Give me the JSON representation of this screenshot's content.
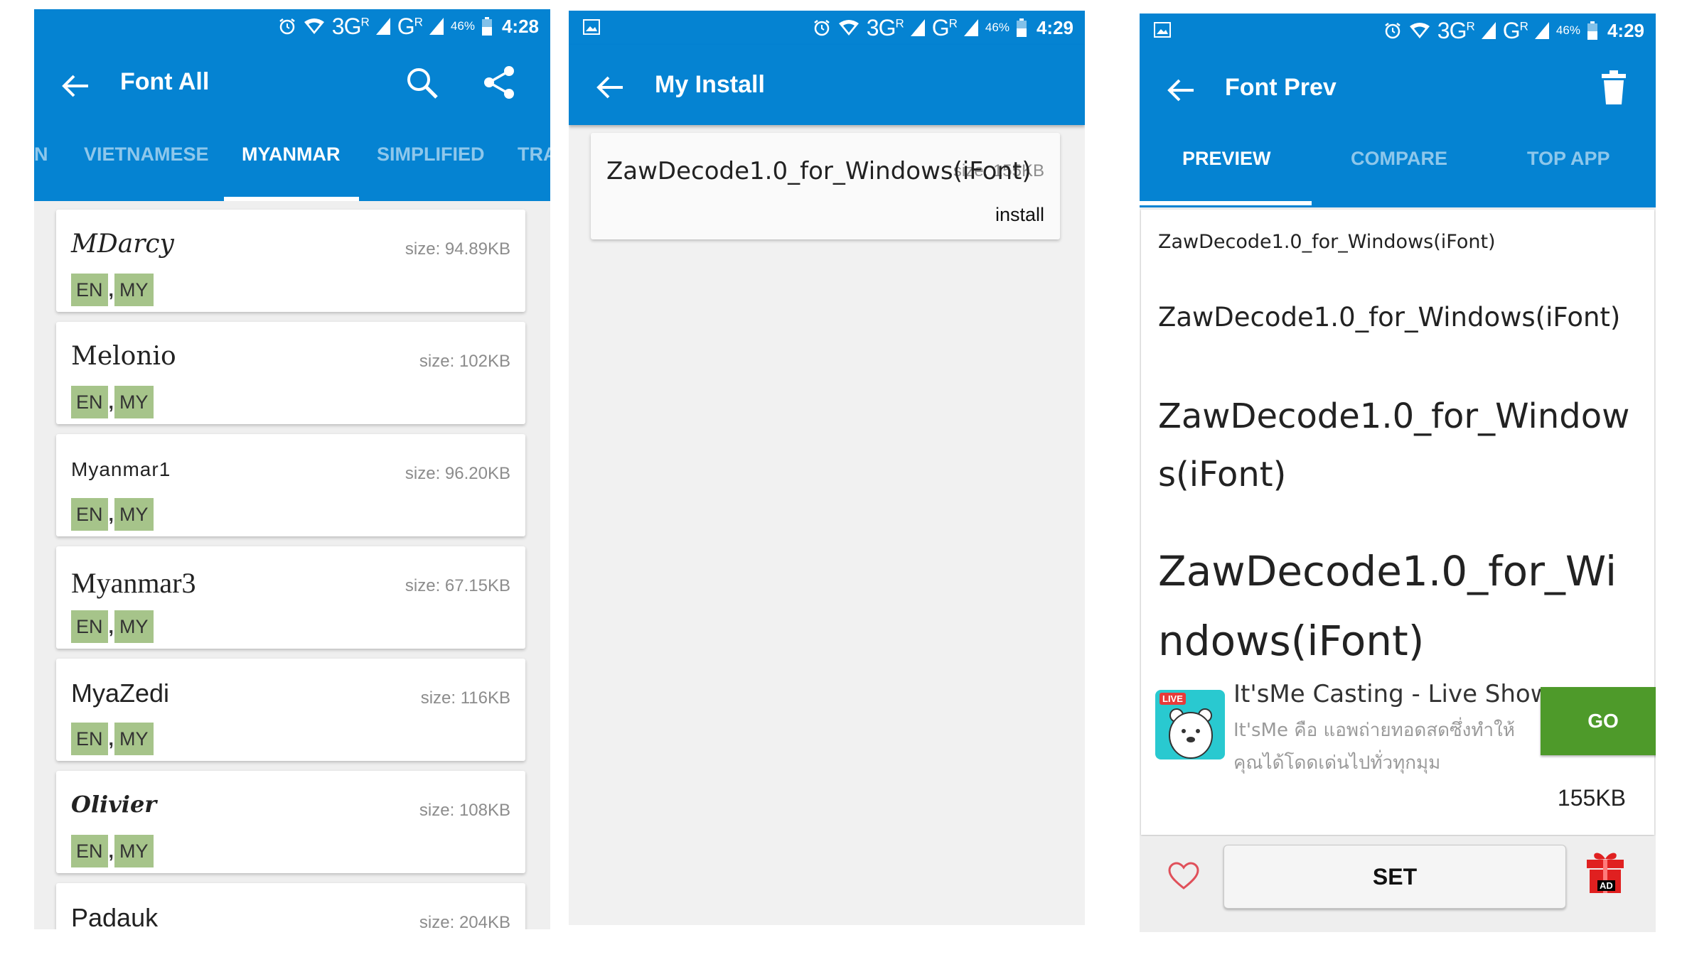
{
  "statusbar": {
    "screen1": {
      "battery": "46%",
      "time": "4:28",
      "net1": "3G",
      "net2": "G",
      "roaming": "R"
    },
    "screen2": {
      "battery": "46%",
      "time": "4:29",
      "net1": "3G",
      "net2": "G",
      "roaming": "R"
    },
    "screen3": {
      "battery": "46%",
      "time": "4:29",
      "net1": "3G",
      "net2": "G",
      "roaming": "R"
    }
  },
  "screen1": {
    "title": "Font All",
    "tabs": [
      "N",
      "VIETNAMESE",
      "MYANMAR",
      "SIMPLIFIED",
      "TRA"
    ],
    "active_tab": "MYANMAR",
    "fonts": [
      {
        "name": "MDarcy",
        "size": "size: 94.89KB",
        "tag1": "EN",
        "sep": ",",
        "tag2": "MY"
      },
      {
        "name": "Melonio",
        "size": "size: 102KB",
        "tag1": "EN",
        "sep": ",",
        "tag2": "MY"
      },
      {
        "name": "Myanmar1",
        "size": "size: 96.20KB",
        "tag1": "EN",
        "sep": ",",
        "tag2": "MY"
      },
      {
        "name": "Myanmar3",
        "size": "size: 67.15KB",
        "tag1": "EN",
        "sep": ",",
        "tag2": "MY"
      },
      {
        "name": "MyaZedi",
        "size": "size: 116KB",
        "tag1": "EN",
        "sep": ",",
        "tag2": "MY"
      },
      {
        "name": "Olivier",
        "size": "size: 108KB",
        "tag1": "EN",
        "sep": ",",
        "tag2": "MY"
      },
      {
        "name": "Padauk",
        "size": "size: 204KB",
        "tag1": "",
        "sep": "",
        "tag2": ""
      }
    ]
  },
  "screen2": {
    "title": "My Install",
    "item": {
      "name": "ZawDecode1.0_for_Windows(iFont)",
      "size": "size: 155KB",
      "action": "install"
    }
  },
  "screen3": {
    "title": "Font Prev",
    "tabs": [
      "PREVIEW",
      "COMPARE",
      "TOP APP"
    ],
    "active_tab": "PREVIEW",
    "preview_samples": [
      "ZawDecode1.0_for_Windows(iFont)",
      "ZawDecode1.0_for_Windows(iFont)",
      "ZawDecode1.0_for_Windows(iFont)",
      "ZawDecode1.0_for_Windows(iFont)"
    ],
    "ad": {
      "badge": "LIVE",
      "title": "It'sMe Casting - Live Show",
      "description": "It'sMe คือ แอพถ่ายทอดสดซึ่งทำให้คุณได้โดดเด่นไปทั่วทุกมุม",
      "cta": "GO"
    },
    "file_size": "155KB",
    "set_button": "SET",
    "gift_badge": "AD"
  },
  "colors": {
    "primary": "#0583d2",
    "tag_bg": "#a6c48a",
    "ad_cta": "#4e9a2a",
    "heart": "#e0505a",
    "gift": "#e02020"
  }
}
